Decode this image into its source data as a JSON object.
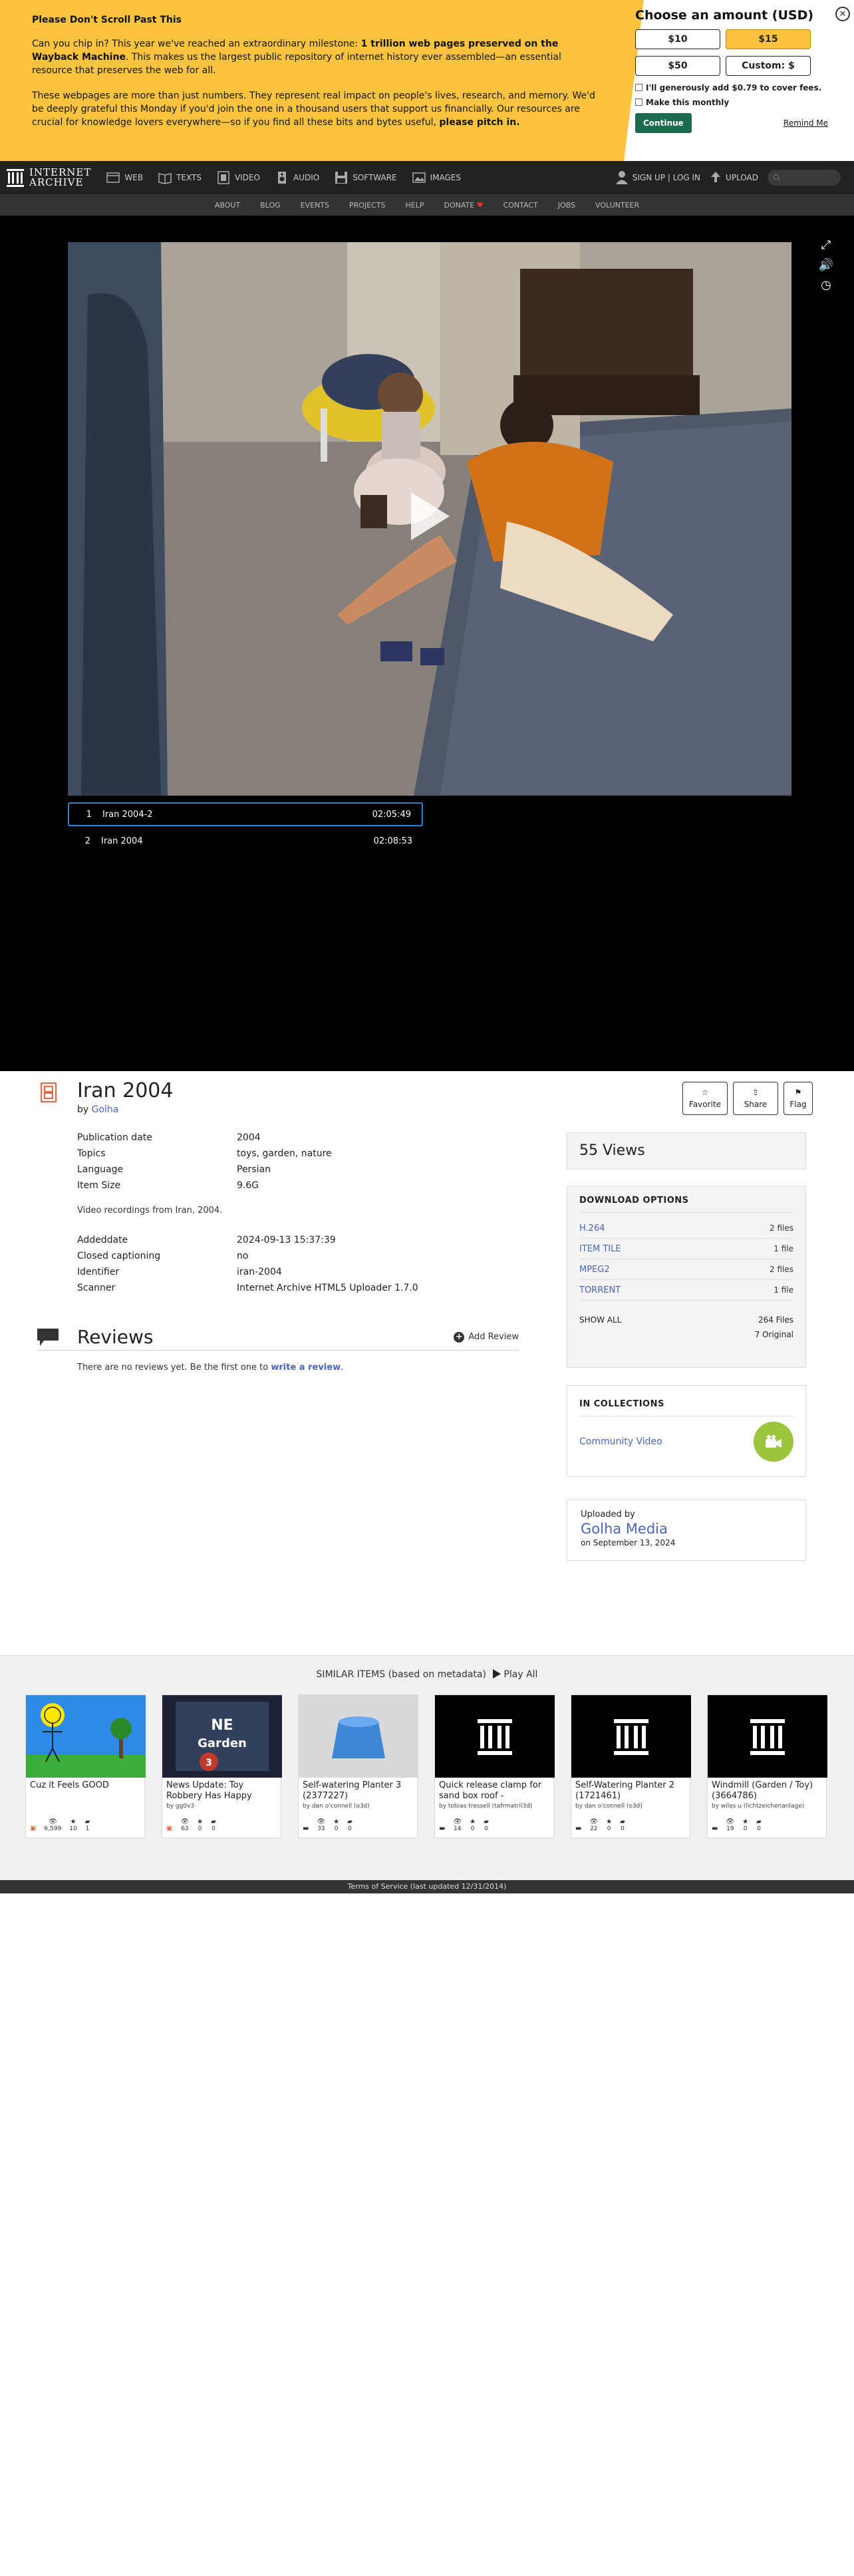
{
  "banner": {
    "heading": "Please Don't Scroll Past This",
    "p1_a": "Can you chip in? This year we've reached an extraordinary milestone: ",
    "p1_b": "1 trillion web pages preserved on the Wayback Machine",
    "p1_c": ". This makes us the largest public repository of internet history ever assembled—an essential resource that preserves the web for all.",
    "p2_a": "These webpages are more than just numbers. They represent real impact on people's lives, research, and memory. We'd be deeply grateful this Monday if you'd join the one in a thousand users that support us financially. Our resources are crucial for knowledge lovers everywhere—so if you find all these bits and bytes useful, ",
    "p2_b": "please pitch in.",
    "box_title": "Choose an amount (USD)",
    "amounts": [
      "$10",
      "$15",
      "$50",
      "Custom: $"
    ],
    "cover_fees": "I'll generously add $0.79 to cover fees.",
    "monthly": "Make this monthly",
    "continue": "Continue",
    "remind": "Remind Me",
    "close": "✕"
  },
  "nav": {
    "logo_line1": "INTERNET",
    "logo_line2": "ARCHIVE",
    "items": [
      "WEB",
      "TEXTS",
      "VIDEO",
      "AUDIO",
      "SOFTWARE",
      "IMAGES"
    ],
    "signin": "SIGN UP | LOG IN",
    "upload": "UPLOAD",
    "sub": [
      "ABOUT",
      "BLOG",
      "EVENTS",
      "PROJECTS",
      "HELP",
      "DONATE",
      "CONTACT",
      "JOBS",
      "VOLUNTEER"
    ]
  },
  "playlist": [
    {
      "num": "1",
      "title": "Iran 2004-2",
      "duration": "02:05:49"
    },
    {
      "num": "2",
      "title": "Iran 2004",
      "duration": "02:08:53"
    }
  ],
  "item": {
    "title": "Iran 2004",
    "by_label": "by",
    "by": "Golha",
    "actions": [
      "Favorite",
      "Share",
      "Flag"
    ],
    "meta1": [
      {
        "k": "Publication date",
        "v": "2004",
        "link": true
      },
      {
        "k": "Topics",
        "v": "toys, garden, nature",
        "link": true
      },
      {
        "k": "Language",
        "v": "Persian",
        "link": true
      },
      {
        "k": "Item Size",
        "v": "9.6G",
        "link": false
      }
    ],
    "description": "Video recordings from Iran, 2004.",
    "meta2": [
      {
        "k": "Addeddate",
        "v": "2024-09-13 15:37:39"
      },
      {
        "k": "Closed captioning",
        "v": "no"
      },
      {
        "k": "Identifier",
        "v": "iran-2004"
      },
      {
        "k": "Scanner",
        "v": "Internet Archive HTML5 Uploader 1.7.0"
      }
    ]
  },
  "reviews": {
    "title": "Reviews",
    "add": "Add Review",
    "none_a": "There are no reviews yet. Be the first one to ",
    "none_link": "write a review",
    "none_b": "."
  },
  "views": "55 Views",
  "downloads": {
    "title": "DOWNLOAD OPTIONS",
    "files": [
      {
        "name": "H.264",
        "count": "2 files"
      },
      {
        "name": "ITEM TILE",
        "count": "1 file"
      },
      {
        "name": "MPEG2",
        "count": "2 files"
      },
      {
        "name": "TORRENT",
        "count": "1 file"
      }
    ],
    "show_all": "SHOW ALL",
    "total": "264 Files",
    "original": "7 Original"
  },
  "collections": {
    "title": "IN COLLECTIONS",
    "name": "Community Video"
  },
  "uploader": {
    "label": "Uploaded by",
    "name": "Golha Media",
    "date": "on September 13, 2024"
  },
  "similar": {
    "heading": "SIMILAR ITEMS (based on metadata)",
    "play_all": "Play All",
    "cards": [
      {
        "title": "Cuz it Feels GOOD",
        "by": "",
        "stats": [
          "6,599",
          "10",
          "1"
        ]
      },
      {
        "title": "News Update: Toy Robbery Has Happy",
        "by": "by gg0v3",
        "stats": [
          "63",
          "0",
          "0"
        ]
      },
      {
        "title": "Self-watering Planter 3 (2377227)",
        "by": "by dan o'connell (o3d)",
        "stats": [
          "33",
          "0",
          "0"
        ]
      },
      {
        "title": "Quick release clamp for sand box roof -",
        "by": "by tobias tressell (tafrmatril3d)",
        "stats": [
          "14",
          "0",
          "0"
        ]
      },
      {
        "title": "Self-Watering Planter 2 (1721461)",
        "by": "by dan o'connell (o3d)",
        "stats": [
          "22",
          "0",
          "0"
        ]
      },
      {
        "title": "Windmill (Garden / Toy) (3664786)",
        "by": "by wiles u (lichtzeichenanlage)",
        "stats": [
          "19",
          "0",
          "0"
        ]
      }
    ]
  },
  "footer": "Terms of Service (last updated 12/31/2014)"
}
